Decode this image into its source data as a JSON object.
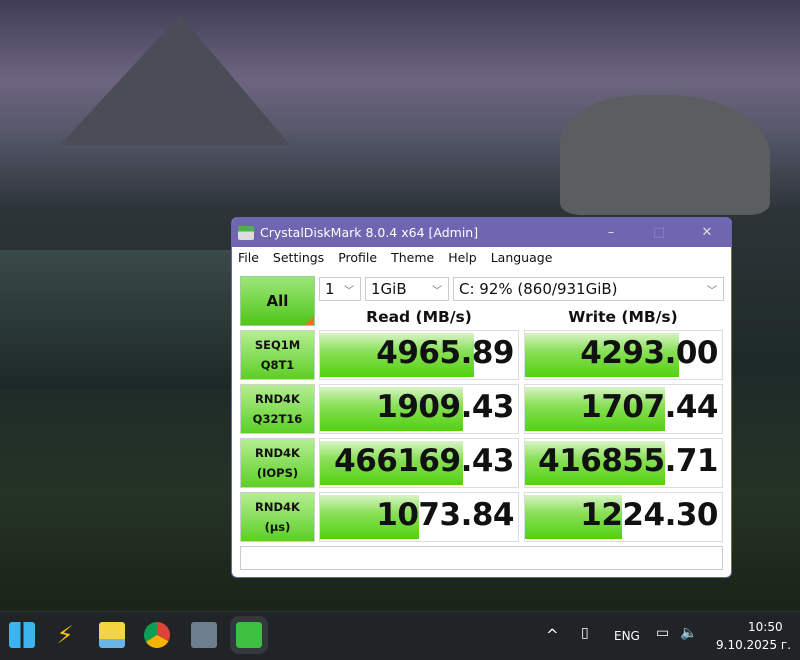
{
  "window": {
    "title": "CrystalDiskMark 8.0.4 x64 [Admin]",
    "minimize": "–",
    "maximize": "□",
    "close": "✕"
  },
  "menu": [
    "File",
    "Settings",
    "Profile",
    "Theme",
    "Help",
    "Language"
  ],
  "controls": {
    "all_label": "All",
    "count": "1",
    "size": "1GiB",
    "drive": "C: 92% (860/931GiB)"
  },
  "headers": {
    "read": "Read (MB/s)",
    "write": "Write (MB/s)"
  },
  "rows": [
    {
      "l1": "SEQ1M",
      "l2": "Q8T1",
      "read": "4965.89",
      "write": "4293.00",
      "read_fill": 0.78,
      "write_fill": 0.78
    },
    {
      "l1": "RND4K",
      "l2": "Q32T16",
      "read": "1909.43",
      "write": "1707.44",
      "read_fill": 0.72,
      "write_fill": 0.71
    },
    {
      "l1": "RND4K",
      "l2": "(IOPS)",
      "read": "466169.43",
      "write": "416855.71",
      "read_fill": 0.72,
      "write_fill": 0.71
    },
    {
      "l1": "RND4K",
      "l2": "(µs)",
      "read": "1073.84",
      "write": "1224.30",
      "read_fill": 0.5,
      "write_fill": 0.49
    }
  ],
  "comment": "",
  "taskbar": {
    "chevron": "^",
    "lang": "ENG",
    "time": "10:50",
    "date": "9.10.2025 г."
  }
}
